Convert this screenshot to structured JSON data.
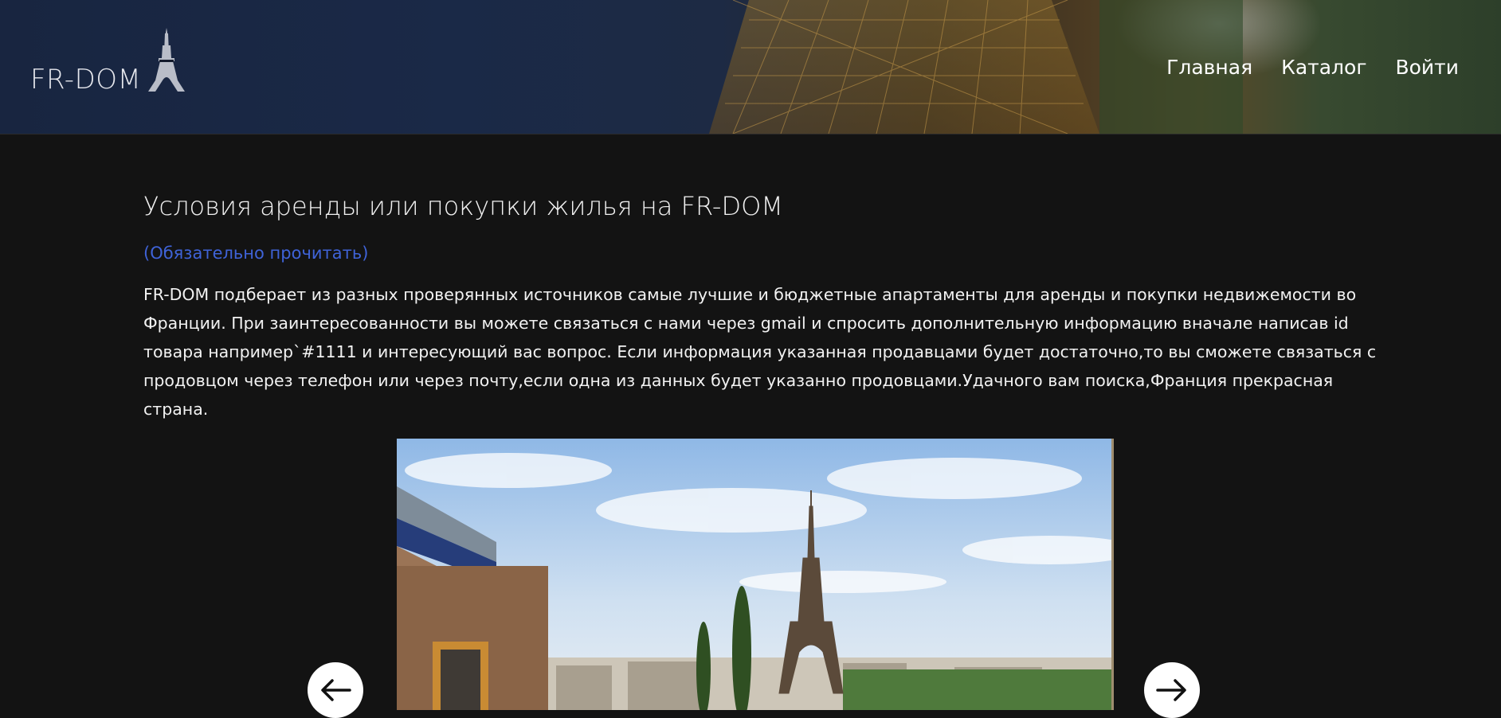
{
  "brand": {
    "name": "FR-DOM",
    "icon": "eiffel-tower-icon"
  },
  "nav": {
    "items": [
      "Главная",
      "Каталог",
      "Войти"
    ]
  },
  "main": {
    "title": "Условия аренды или покупки жилья на FR-DOM",
    "note": "(Обязательно прочитать)",
    "description": "FR-DOM подберает из разных проверянных источников самые лучшие и бюджетные апартаменты для аренды и покупки недвижемости во Франции. При заинтересованности вы можете связаться с нами через gmail и спросить дополнительную информацию вначале написав id товара например`#1111 и интересующий вас вопрос. Если информация указанная продавцами будет достаточно,то вы сможете связаться с продовцом через телефон или через почту,если одна из данных будет указанно продовцами.Удачного вам поиска,Франция прекрасная страна."
  },
  "slider": {
    "prev_icon": "arrow-left-icon",
    "next_icon": "arrow-right-icon"
  },
  "colors": {
    "background": "#131313",
    "link": "#3f63d8",
    "text": "#f2f2f2"
  }
}
